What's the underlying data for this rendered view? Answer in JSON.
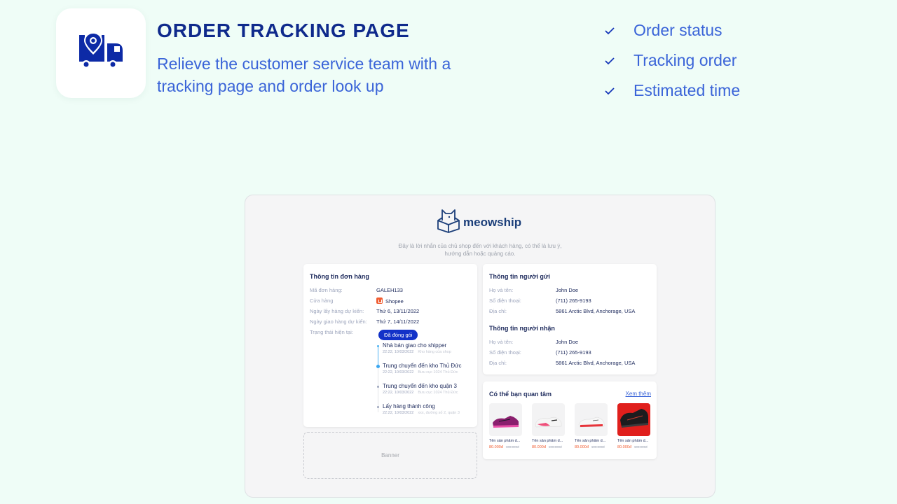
{
  "hero": {
    "icon": "location-truck-icon",
    "title": "ORDER TRACKING PAGE",
    "subtitle": "Relieve the customer service team with a tracking page and order look up"
  },
  "features": [
    {
      "icon": "check-icon",
      "label": "Order status"
    },
    {
      "icon": "check-icon",
      "label": "Tracking order"
    },
    {
      "icon": "check-icon",
      "label": "Estimated time"
    }
  ],
  "preview": {
    "brand": {
      "logo": "cat-box-logo-icon",
      "name": "meowship"
    },
    "note_line1": "Đây là lời nhắn của chủ shop đến với khách hàng, có thể là lưu ý,",
    "note_line2": "hướng dẫn hoặc quảng cáo.",
    "order": {
      "title": "Thông tin đơn hàng",
      "rows": [
        {
          "label": "Mã đơn hàng:",
          "value": "GALEH133"
        },
        {
          "label": "Cửa hàng",
          "value": "Shopee",
          "icon": "shopee-icon"
        },
        {
          "label": "Ngày lấy hàng dự kiến:",
          "value": "Thứ 6, 13/11/2022"
        },
        {
          "label": "Ngày giao hàng dự kiến:",
          "value": "Thứ 7, 14/11/2022"
        },
        {
          "label": "Trạng thái hiện tại:",
          "value": ""
        }
      ],
      "status_badge": "Đã đóng gói",
      "timeline": [
        {
          "title": "Nhà bán giao cho shipper",
          "time": "22:22, 10/03/2022",
          "place": "Kho hàng của shop"
        },
        {
          "title": "Trung chuyển đến kho Thủ Đức",
          "time": "22:22, 10/03/2022",
          "place": "Bưu cục 1024 Thủ Đức"
        },
        {
          "title": "Trung chuyển đến kho quận 3",
          "time": "22:22, 10/03/2022",
          "place": "Bưu cục 1024 Thủ Đức"
        },
        {
          "title": "Lấy hàng thành công",
          "time": "22:22, 10/03/2022",
          "place": "xxx, đường số 2, quận 3"
        }
      ]
    },
    "banner_label": "Banner",
    "sender": {
      "title": "Thông tin người gửi",
      "rows": [
        {
          "label": "Họ và tên:",
          "value": "John Doe"
        },
        {
          "label": "Số điện thoại:",
          "value": "(711) 265-9193"
        },
        {
          "label": "Địa chỉ:",
          "value": "5861 Arctic Blvd, Anchorage, USA"
        }
      ]
    },
    "receiver": {
      "title": "Thông tin người nhận",
      "rows": [
        {
          "label": "Họ và tên:",
          "value": "John Doe"
        },
        {
          "label": "Số điện thoại:",
          "value": "(711) 265-9193"
        },
        {
          "label": "Địa chỉ:",
          "value": "5861 Arctic Blvd, Anchorage, USA"
        }
      ]
    },
    "recommend": {
      "title": "Có thể bạn quan tâm",
      "see_more": "Xem thêm",
      "products": [
        {
          "name": "Tên sản phẩm d...",
          "price": "80.000đ",
          "old_price": "100.000đ",
          "image": "shoe-pink-purple"
        },
        {
          "name": "Tên sản phẩm d...",
          "price": "80.000đ",
          "old_price": "100.000đ",
          "image": "shoe-white-pink"
        },
        {
          "name": "Tên sản phẩm d...",
          "price": "80.000đ",
          "old_price": "100.000đ",
          "image": "shoe-white-red"
        },
        {
          "name": "Tên sản phẩm d...",
          "price": "80.000đ",
          "old_price": "100.000đ",
          "image": "shoe-black-red"
        }
      ]
    }
  },
  "colors": {
    "background": "#effdf7",
    "title": "#0f2a8c",
    "accent": "#3a64d8",
    "badge": "#1232c8",
    "price": "#f05d32"
  }
}
